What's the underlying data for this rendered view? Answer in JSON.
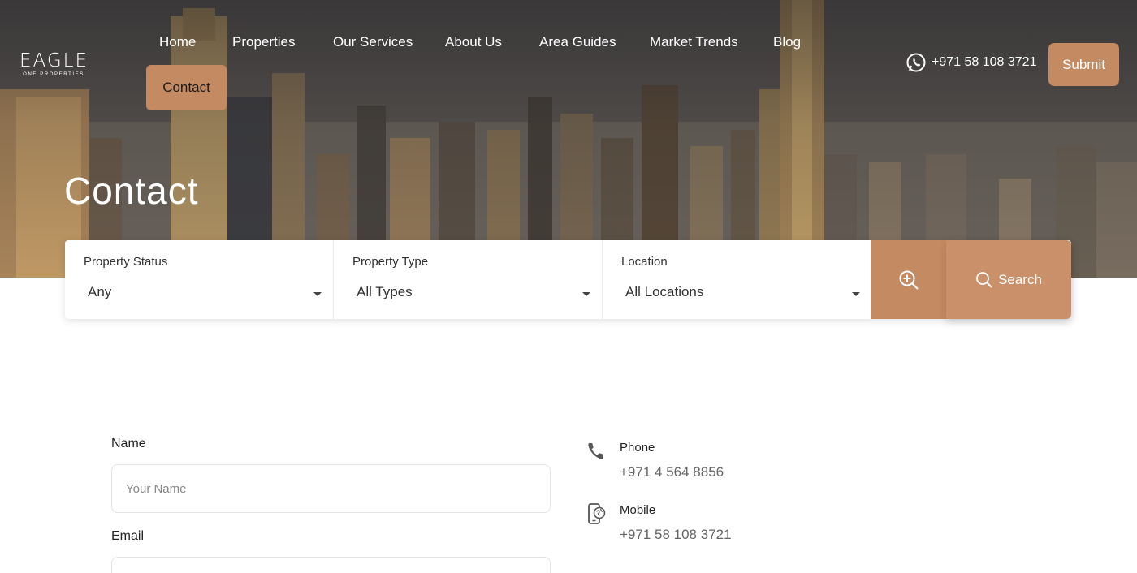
{
  "brand": {
    "logo_main": "EAGLE",
    "logo_sub": "ONE PROPERTIES"
  },
  "nav": {
    "items": [
      "Home",
      "Properties",
      "Our Services",
      "About Us",
      "Area Guides",
      "Market Trends",
      "Blog"
    ],
    "contact": "Contact"
  },
  "header": {
    "phone": "+971 58 108 3721",
    "submit": "Submit",
    "whatsapp_icon": "whatsapp-icon"
  },
  "hero": {
    "title": "Contact"
  },
  "search": {
    "status_label": "Property Status",
    "status_value": "Any",
    "type_label": "Property Type",
    "type_value": "All Types",
    "location_label": "Location",
    "location_value": "All Locations",
    "search_label": "Search"
  },
  "form": {
    "name_label": "Name",
    "name_placeholder": "Your Name",
    "email_label": "Email"
  },
  "contact_info": [
    {
      "title": "Phone",
      "value": "+971 4 564 8856",
      "icon": "phone-icon"
    },
    {
      "title": "Mobile",
      "value": "+971 58 108 3721",
      "icon": "mobile-icon"
    }
  ],
  "colors": {
    "accent": "#c48a62",
    "text": "#222222"
  }
}
